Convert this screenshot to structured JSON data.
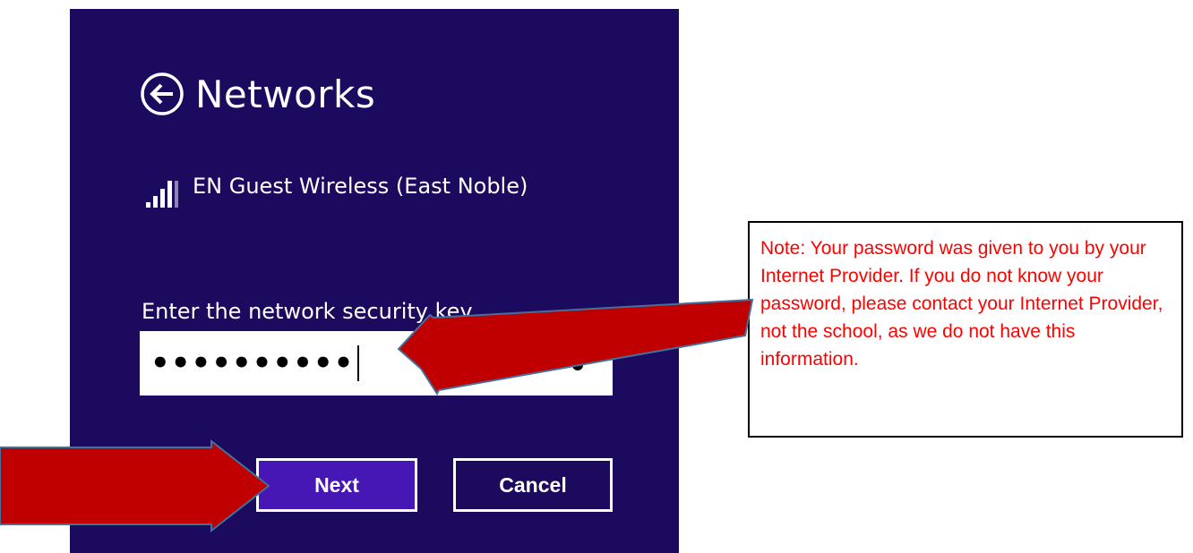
{
  "header": {
    "title": "Networks",
    "back_icon": "back-arrow-circle-icon"
  },
  "network": {
    "name": "EN Guest Wireless (East Noble)",
    "signal_icon": "wifi-signal-bars-icon"
  },
  "security_key": {
    "label": "Enter the network security key",
    "masked_value": "••••••••••",
    "reveal_icon": "reveal-password-eye-icon"
  },
  "buttons": {
    "next_label": "Next",
    "cancel_label": "Cancel"
  },
  "note": {
    "text": "Note:  Your password was given to you by your Internet Provider.  If you do not know your password, please contact your Internet Provider, not the school, as we do not have this information."
  },
  "colors": {
    "panel_background": "#1b0a5e",
    "next_button": "#4617b4",
    "arrow_fill": "#c00000",
    "arrow_outline": "#41719c",
    "note_text": "#ff0000"
  }
}
